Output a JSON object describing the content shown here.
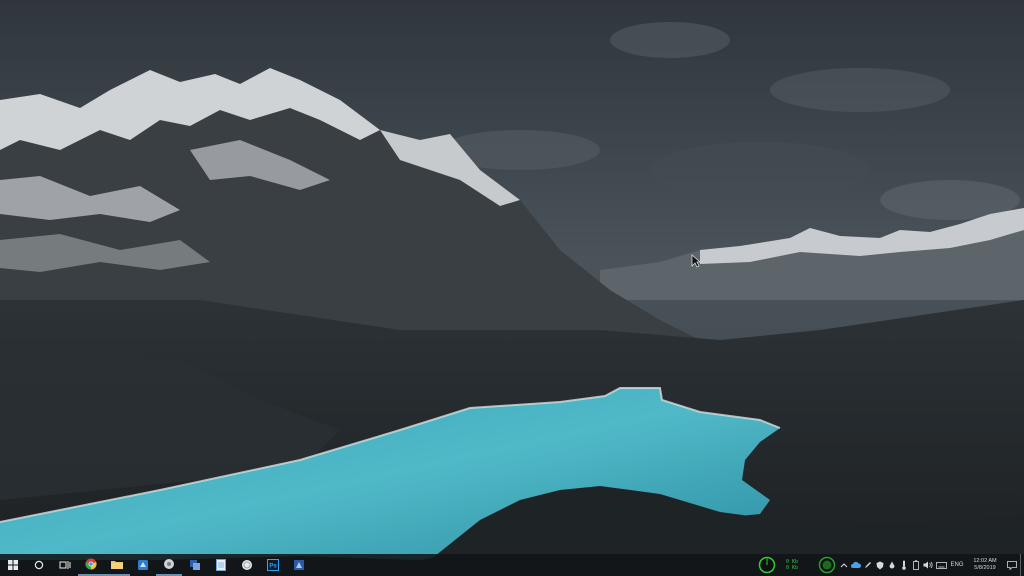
{
  "wallpaper": {
    "description_colors": {
      "sky": "#3a434b",
      "lake": "#4bb5c4",
      "snow": "#dcdcdc"
    }
  },
  "taskbar": {
    "background": "#121518",
    "pinned": [
      {
        "name": "start-button",
        "icon": "windows-logo-icon"
      },
      {
        "name": "search-button",
        "icon": "cortana-circle-icon"
      },
      {
        "name": "task-view-button",
        "icon": "task-view-icon"
      },
      {
        "name": "chrome-button",
        "icon": "chrome-icon"
      },
      {
        "name": "file-explorer-button",
        "icon": "folder-icon"
      },
      {
        "name": "app-button-1",
        "icon": "app-icon"
      },
      {
        "name": "app-button-2",
        "icon": "app-icon"
      },
      {
        "name": "app-button-3",
        "icon": "app-icon"
      },
      {
        "name": "notepad-button",
        "icon": "notepad-icon"
      },
      {
        "name": "app-button-4",
        "icon": "app-icon"
      },
      {
        "name": "photoshop-button",
        "icon": "photoshop-icon",
        "label": "Ps"
      },
      {
        "name": "app-button-5",
        "icon": "app-icon"
      }
    ]
  },
  "tray": {
    "net_up": "0 Kb",
    "net_down": "0 Kb",
    "language": "ENG",
    "time": "12:02 AM",
    "date": "5/8/2019",
    "cpu_gauge_color": "#33cc33"
  }
}
